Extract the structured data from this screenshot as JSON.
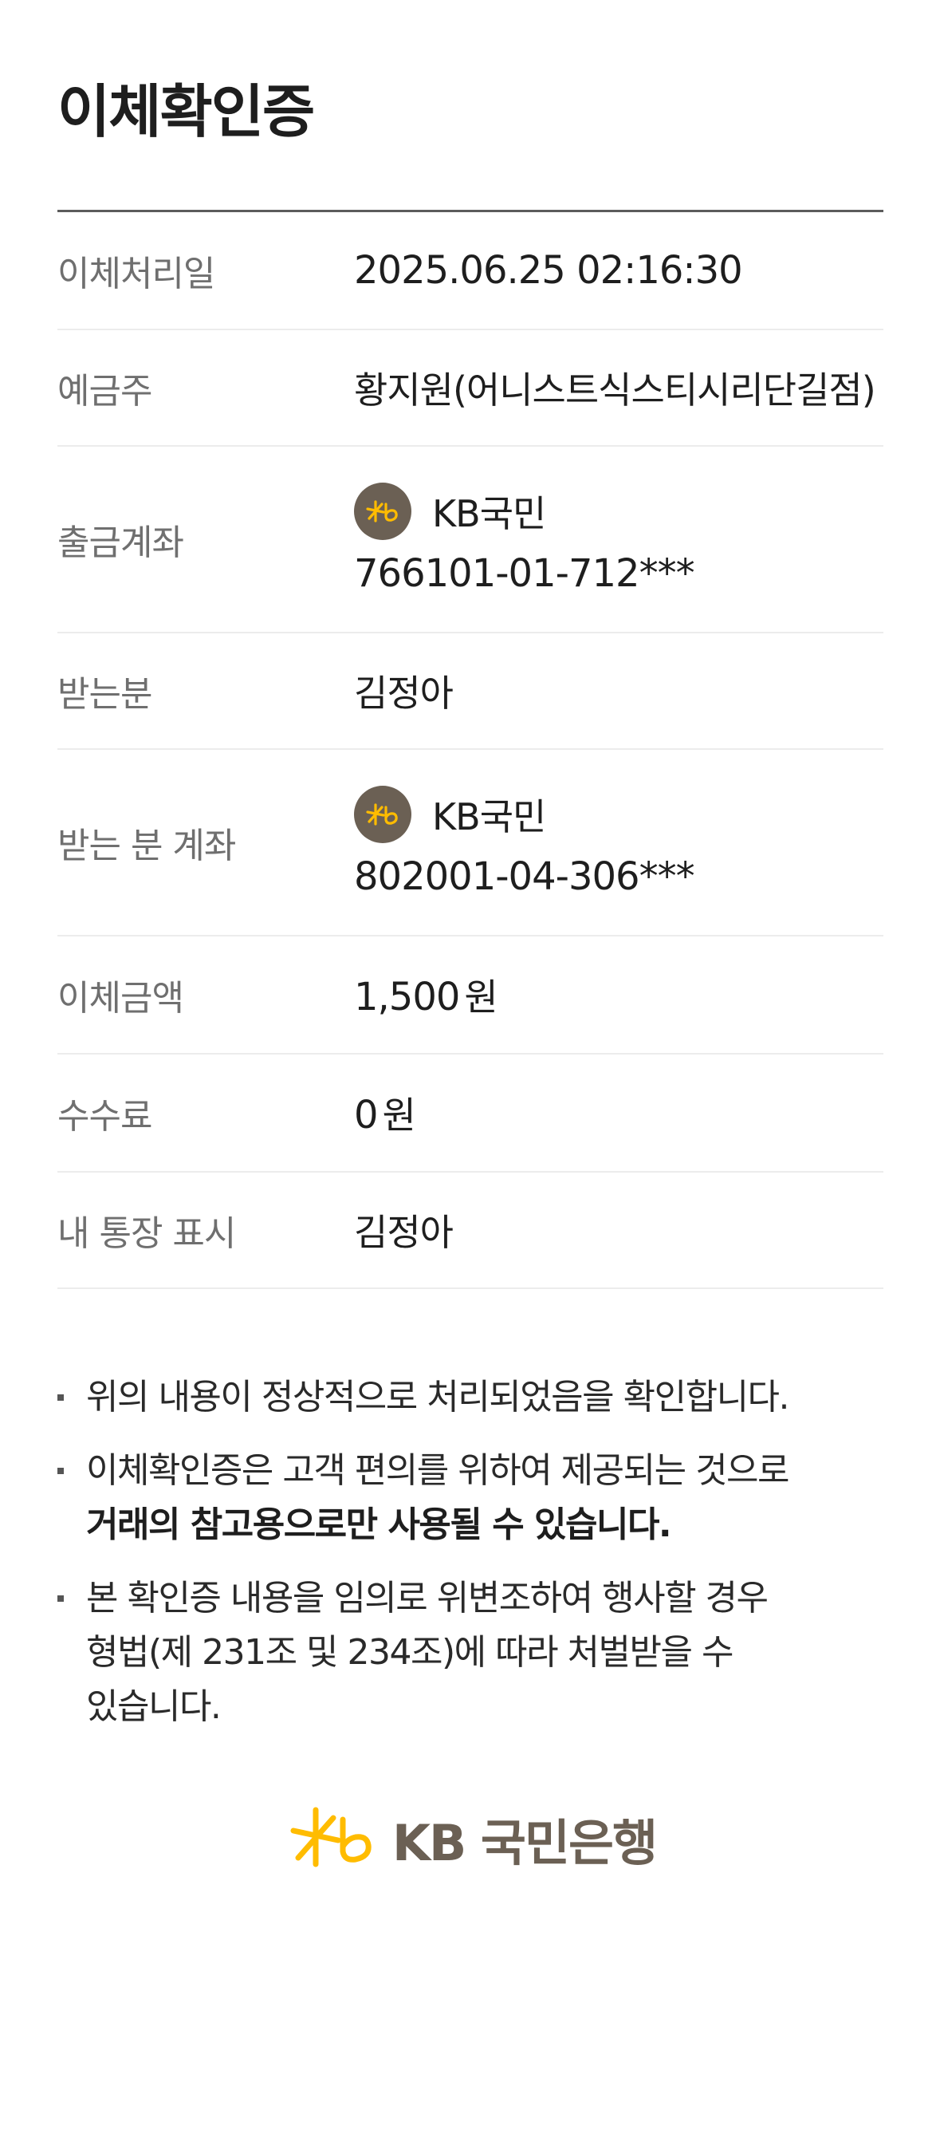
{
  "header": {
    "title": "이체확인증"
  },
  "details": {
    "transfer_date": {
      "label": "이체처리일",
      "value": "2025.06.25 02:16:30"
    },
    "depositor": {
      "label": "예금주",
      "value": "황지원(어니스트식스티시리단길점)"
    },
    "from_account": {
      "label": "출금계좌",
      "bank": "KB국민",
      "number": "766101-01-712***"
    },
    "recipient": {
      "label": "받는분",
      "value": "김정아"
    },
    "to_account": {
      "label": "받는 분 계좌",
      "bank": "KB국민",
      "number": "802001-04-306***"
    },
    "amount": {
      "label": "이체금액",
      "value": "1,500",
      "unit": "원"
    },
    "fee": {
      "label": "수수료",
      "value": "0",
      "unit": "원"
    },
    "my_passbook_memo": {
      "label": "내 통장 표시",
      "value": "김정아"
    }
  },
  "notes": [
    {
      "lines": [
        "위의 내용이 정상적으로 처리되었음을 확인합니다."
      ]
    },
    {
      "lines": [
        "이체확인증은 고객 편의를 위하여 제공되는 것으로"
      ],
      "bold_line": "거래의 참고용으로만 사용될 수 있습니다."
    },
    {
      "lines": [
        "본 확인증 내용을 임의로 위변조하여 행사할 경우",
        "형법(제 231조 및 234조)에 따라 처벌받을 수",
        "있습니다."
      ]
    }
  ],
  "footer": {
    "logo_text": "KB 국민은행"
  },
  "colors": {
    "brand_brown": "#6b6054",
    "brand_yellow": "#ffbc00",
    "label_gray": "#6f6f6f",
    "divider": "#ececec"
  },
  "icons": {
    "bank_logo": "kb-star-logo-icon"
  }
}
